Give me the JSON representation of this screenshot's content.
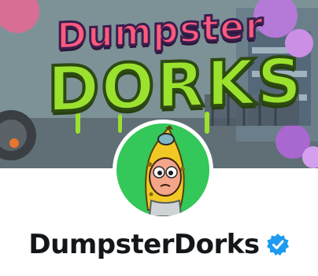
{
  "banner": {
    "logo_line1": "Dumpster",
    "logo_line2": "DORKS"
  },
  "profile": {
    "display_name": "DumpsterDorks",
    "verified": true,
    "avatar_bg": "#34c759",
    "verified_color": "#1d9bf0"
  },
  "icons": {
    "verified": "verified-badge-icon"
  }
}
